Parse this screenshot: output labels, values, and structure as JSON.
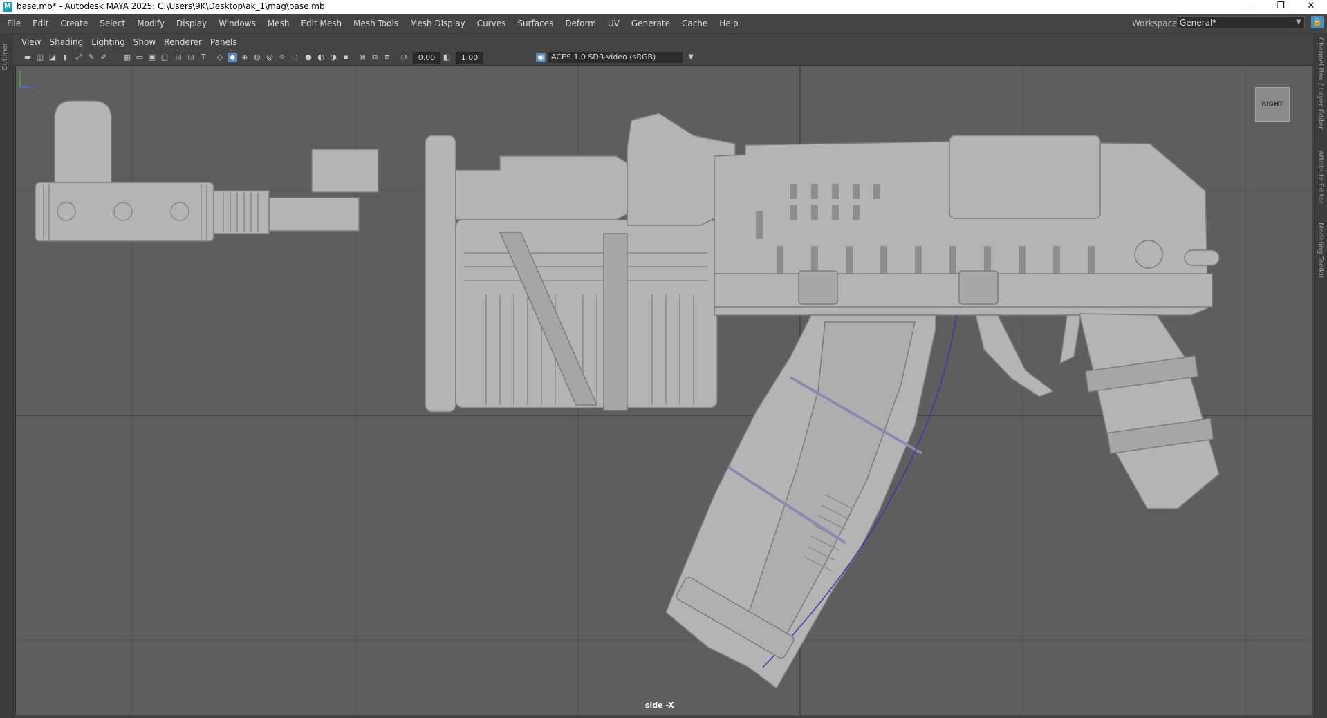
{
  "window": {
    "title": "base.mb* - Autodesk MAYA 2025: C:\\Users\\9K\\Desktop\\ak_1\\mag\\base.mb",
    "app_icon_letter": "M",
    "minimize": "—",
    "restore": "❐",
    "close": "✕"
  },
  "menubar": {
    "items": [
      "File",
      "Edit",
      "Create",
      "Select",
      "Modify",
      "Display",
      "Windows",
      "Mesh",
      "Edit Mesh",
      "Mesh Tools",
      "Mesh Display",
      "Curves",
      "Surfaces",
      "Deform",
      "UV",
      "Generate",
      "Cache",
      "Help"
    ],
    "workspace_label": "Workspace:",
    "workspace_value": "General*"
  },
  "left_strip": {
    "label": "Outliner"
  },
  "right_strip": {
    "tabs": [
      "Channel Box / Layer Editor",
      "Attribute Editor",
      "Modeling Toolkit"
    ]
  },
  "panel_menu": {
    "items": [
      "View",
      "Shading",
      "Lighting",
      "Show",
      "Renderer",
      "Panels"
    ]
  },
  "toolbar": {
    "exposure": "0.00",
    "gamma": "1.00",
    "color_space": "ACES 1.0 SDR-video (sRGB)"
  },
  "viewport": {
    "view_cube_label": "RIGHT",
    "camera_label": "side -X"
  },
  "colors": {
    "viewport_bg": "#5e5e5e",
    "grid": "#4e4e4e",
    "grid_axis": "#3f3f3f",
    "mesh": "#b4b4b4",
    "accent": "#5a8ab5"
  }
}
